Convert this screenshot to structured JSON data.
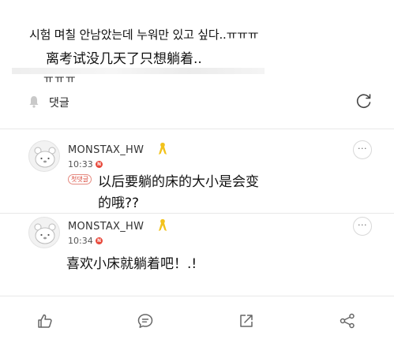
{
  "post": {
    "korean_text": "시험 며칠 안남았는데 누워만 있고 싶다..ㅠㅠㅠ",
    "chinese_caption": "离考试没几天了只想躺着..",
    "tail_text": "ㅠㅠㅠ"
  },
  "comments_header": {
    "title": "댓글",
    "icons": [
      "bell-icon",
      "refresh-icon"
    ]
  },
  "comments": [
    {
      "author": "MONSTAX_HW",
      "time": "10:33",
      "badge": "N",
      "reply_tag": "첫댓글",
      "text_line1": "以后要躺的床的大小是会变",
      "text_line2": "的哦??"
    },
    {
      "author": "MONSTAX_HW",
      "time": "10:34",
      "badge": "N",
      "text_line1": "喜欢小床就躺着吧！.!"
    }
  ],
  "bottom_bar": {
    "icons": [
      "like-icon",
      "comment-icon",
      "share-external-icon",
      "share-icon"
    ]
  },
  "colors": {
    "badge": "#e8483a",
    "ribbon": "#f2c21b",
    "divider": "#e8e8e8"
  }
}
